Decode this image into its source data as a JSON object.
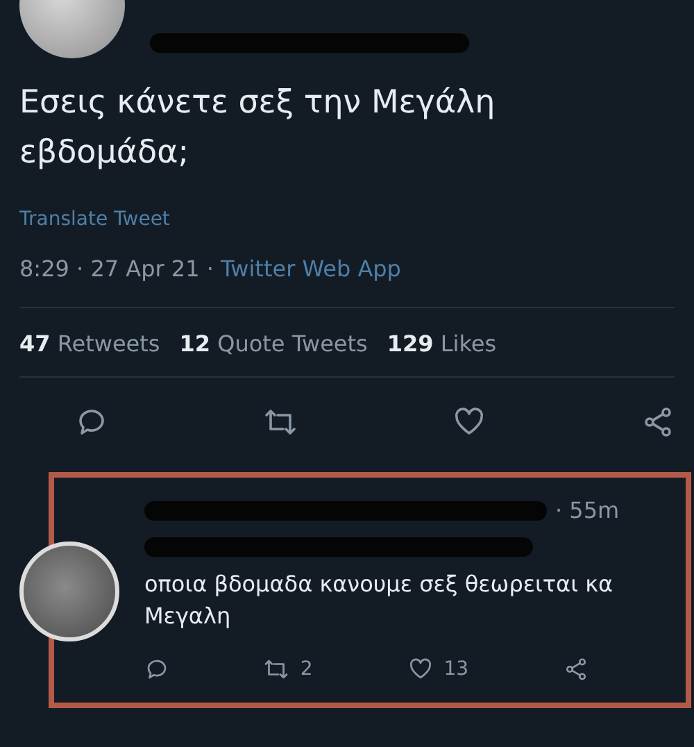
{
  "tweet": {
    "text": "Εσεις κάνετε σεξ την Μεγάλη εβδομάδα;",
    "translate": "Translate Tweet",
    "time": "8:29 · 27 Apr 21 · ",
    "source": "Twitter Web App",
    "stats": [
      {
        "count": "47",
        "label": "Retweets"
      },
      {
        "count": "12",
        "label": "Quote Tweets"
      },
      {
        "count": "129",
        "label": "Likes"
      }
    ],
    "actions": [
      {
        "kind": "reply"
      },
      {
        "kind": "retweet"
      },
      {
        "kind": "like"
      },
      {
        "kind": "share"
      }
    ]
  },
  "reply": {
    "time": "· 55m",
    "text": "οποια βδομαδα κανουμε σεξ θεωρειται κα Μεγαλη",
    "actions": [
      {
        "kind": "reply"
      },
      {
        "kind": "retweet",
        "count": "2"
      },
      {
        "kind": "like",
        "count": "13"
      },
      {
        "kind": "share"
      }
    ]
  }
}
